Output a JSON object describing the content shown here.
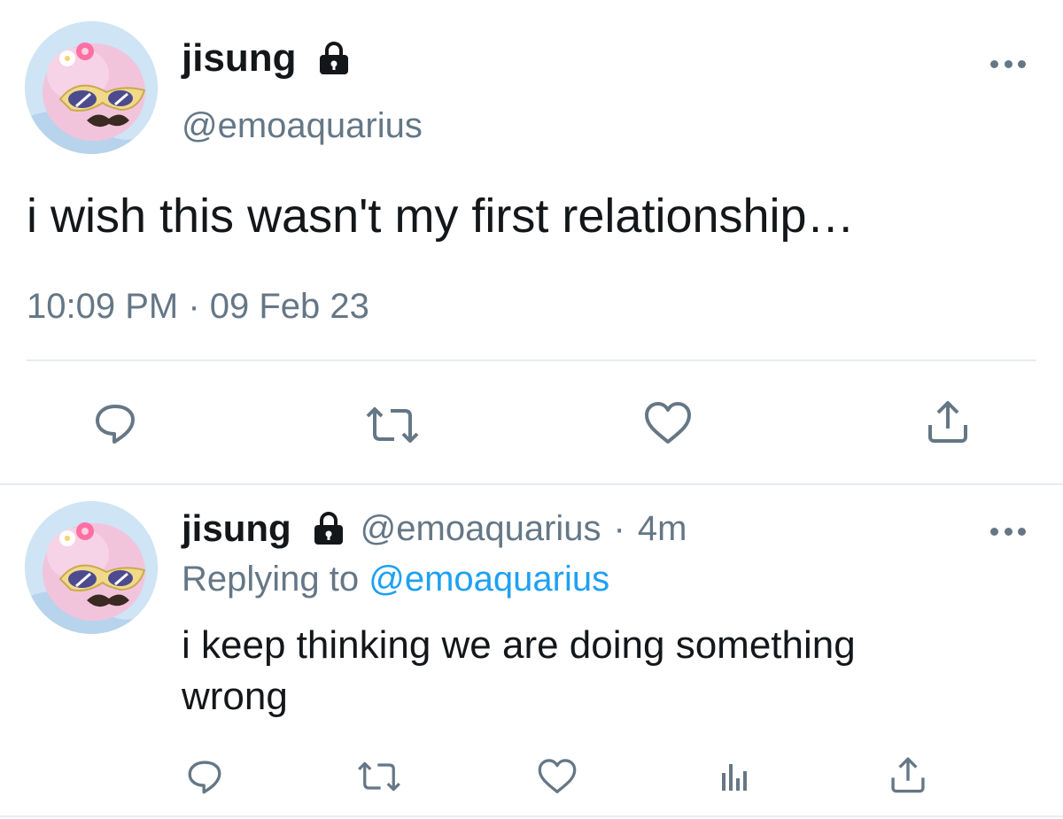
{
  "main_tweet": {
    "display_name": "jisung",
    "handle": "@emoaquarius",
    "text": "i wish this wasn't my first relationship…",
    "timestamp": "10:09 PM · 09 Feb 23",
    "protected_icon": "lock-icon",
    "actions": [
      "reply-icon",
      "retweet-icon",
      "like-icon",
      "share-icon"
    ]
  },
  "reply_tweet": {
    "display_name": "jisung",
    "handle": "@emoaquarius",
    "separator": "·",
    "age": "4m",
    "replying_prefix": "Replying to",
    "replying_handle": "@emoaquarius",
    "text_line1": "i keep thinking we are doing something",
    "text_line2": "wrong",
    "protected_icon": "lock-icon",
    "actions": [
      "reply-icon",
      "retweet-icon",
      "like-icon",
      "analytics-icon",
      "share-icon"
    ]
  },
  "colors": {
    "text": "#14171a",
    "secondary": "#657786",
    "link": "#1da1f2",
    "divider": "#e6ecf0"
  }
}
